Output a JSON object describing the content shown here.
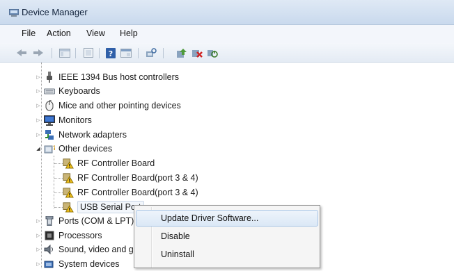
{
  "window": {
    "title": "Device Manager"
  },
  "menubar": {
    "items": [
      "File",
      "Action",
      "View",
      "Help"
    ]
  },
  "toolbar": {
    "icons": [
      "back-arrow-icon",
      "forward-arrow-icon",
      "show-hide-console-tree-icon",
      "properties-icon",
      "help-icon",
      "console-view-icon",
      "scan-hardware-changes-icon",
      "update-driver-icon",
      "uninstall-device-icon",
      "enable-device-icon"
    ]
  },
  "tree": {
    "categories": [
      {
        "label": "IEEE 1394 Bus host controllers",
        "icon": "firewire-icon",
        "expanded": false
      },
      {
        "label": "Keyboards",
        "icon": "keyboard-icon",
        "expanded": false
      },
      {
        "label": "Mice and other pointing devices",
        "icon": "mouse-icon",
        "expanded": false
      },
      {
        "label": "Monitors",
        "icon": "monitor-icon",
        "expanded": false
      },
      {
        "label": "Network adapters",
        "icon": "network-adapter-icon",
        "expanded": false
      },
      {
        "label": "Other devices",
        "icon": "other-devices-icon",
        "expanded": true
      },
      {
        "label": "Ports (COM & LPT)",
        "icon": "port-icon",
        "expanded": false
      },
      {
        "label": "Processors",
        "icon": "processor-icon",
        "expanded": false
      },
      {
        "label": "Sound, video and game controllers",
        "icon": "sound-icon",
        "expanded": false
      },
      {
        "label": "System devices",
        "icon": "system-devices-icon",
        "expanded": false
      }
    ],
    "other_devices_children": [
      {
        "label": "RF Controller Board",
        "icon": "unknown-device-warning-icon"
      },
      {
        "label": "RF Controller Board(port 3 & 4)",
        "icon": "unknown-device-warning-icon"
      },
      {
        "label": "RF Controller Board(port 3 & 4)",
        "icon": "unknown-device-warning-icon"
      },
      {
        "label": "USB Serial Port",
        "icon": "unknown-device-warning-icon",
        "selected": true
      }
    ]
  },
  "context_menu": {
    "items": [
      "Update Driver Software...",
      "Disable",
      "Uninstall"
    ]
  }
}
